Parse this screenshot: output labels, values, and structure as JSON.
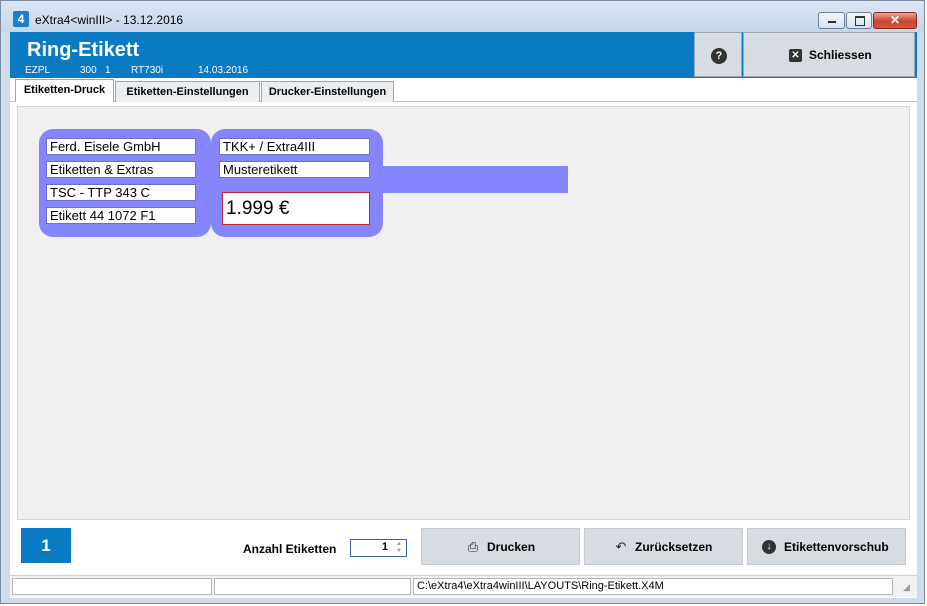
{
  "window": {
    "icon_letter": "4",
    "title": "eXtra4<winIII> - 13.12.2016",
    "controls": {
      "min_label": "",
      "max_label": "",
      "close_label": "✕"
    }
  },
  "header": {
    "title": "Ring-Etikett",
    "sub": [
      "EZPL",
      "300",
      "1",
      "RT730i",
      "14.03.2016"
    ],
    "help_label": "?",
    "close_label": "Schliessen"
  },
  "tabs": [
    {
      "label": "Etiketten-Druck",
      "active": true
    },
    {
      "label": "Etiketten-Einstellungen",
      "active": false
    },
    {
      "label": "Drucker-Einstellungen",
      "active": false
    }
  ],
  "label_preview": {
    "left_lines": [
      "Ferd. Eisele GmbH",
      "Etiketten & Extras",
      "TSC - TTP 343 C",
      "Etikett 44 1072 F1"
    ],
    "right_lines": [
      "TKK+ / Extra4III",
      "Musteretikett"
    ],
    "price": "1.999 €",
    "fill_color": "#8585fd",
    "price_border_color": "#c0262d"
  },
  "bottom": {
    "page_number": "1",
    "count_label": "Anzahl Etiketten",
    "count_value": "1",
    "buttons": [
      {
        "label": "Drucken",
        "icon": "printer-icon"
      },
      {
        "label": "Zurücksetzen",
        "icon": "undo-icon"
      },
      {
        "label": "Etikettenvorschub",
        "icon": "arrow-down-circle-icon"
      }
    ]
  },
  "statusbar": {
    "cells": [
      "",
      "",
      "C:\\eXtra4\\eXtra4winIII\\LAYOUTS\\Ring-Etikett.X4M"
    ]
  },
  "colors": {
    "accent": "#0a7ac3",
    "button_bg": "#d7dce2"
  }
}
